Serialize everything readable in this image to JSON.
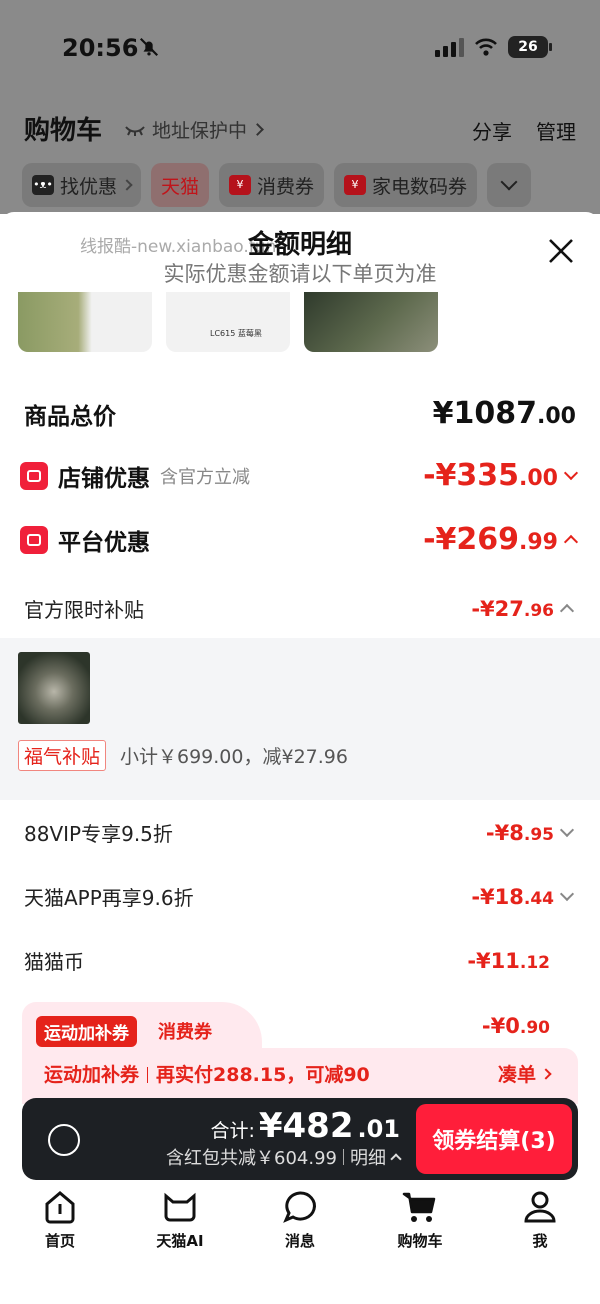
{
  "status": {
    "time": "20:56",
    "battery": "26"
  },
  "header": {
    "title": "购物车",
    "address_protect": "地址保护中",
    "share": "分享",
    "manage": "管理"
  },
  "chips": [
    "找优惠",
    "天猫",
    "消费券",
    "家电数码券"
  ],
  "sheet": {
    "watermark": "线报酷-new.xianbao.fun",
    "title": "金额明细",
    "subtitle": "实际优惠金额请以下单页为准",
    "thumb2_text": "LC615 蓝莓黑"
  },
  "summary": {
    "total_label": "商品总价",
    "total_int": "¥1087",
    "total_dec": ".00",
    "store_label": "店铺优惠",
    "store_note": "含官方立减",
    "store_int": "-¥335",
    "store_dec": ".00",
    "platform_label": "平台优惠",
    "platform_int": "-¥269",
    "platform_dec": ".99",
    "subsidy_label": "官方限时补贴",
    "subsidy_int": "-¥27",
    "subsidy_dec": ".96"
  },
  "subsidy_detail": {
    "tag": "福气补贴",
    "text": "小计￥699.00，减¥27.96"
  },
  "lines": [
    {
      "label": "88VIP专享9.5折",
      "int": "-¥8",
      "dec": ".95"
    },
    {
      "label": "天猫APP再享9.6折",
      "int": "-¥18",
      "dec": ".44"
    },
    {
      "label": "猫猫币",
      "int": "-¥11",
      "dec": ".12"
    }
  ],
  "promo": {
    "tag": "运动加补券",
    "type": "消费券",
    "int": "-¥0",
    "dec": ".90",
    "name": "运动加补券",
    "desc": "再实付288.15，可减90",
    "cta": "凑单"
  },
  "checkout": {
    "total_label": "合计:",
    "total_int": "¥482",
    "total_dec": ".01",
    "saved": "含红包共减￥604.99",
    "detail": "明细",
    "pay": "领券结算(3)"
  },
  "tabs": [
    "首页",
    "天猫AI",
    "消息",
    "购物车",
    "我"
  ],
  "colors": {
    "accent_red": "#e5231b",
    "button_red": "#ff1e3a",
    "bar_dark": "#1d2024"
  }
}
